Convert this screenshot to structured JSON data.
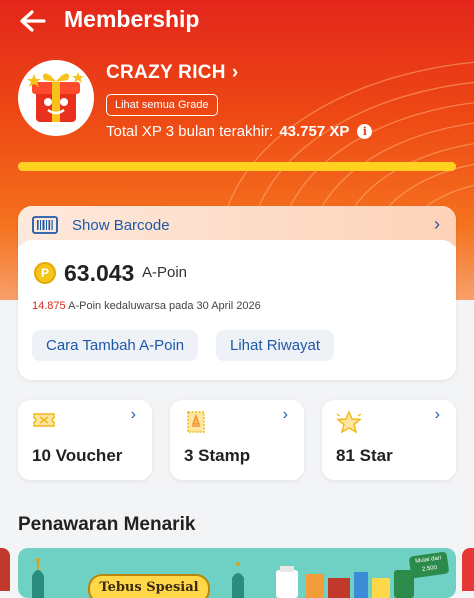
{
  "header": {
    "title": "Membership"
  },
  "profile": {
    "grade": "CRAZY RICH",
    "grade_button": "Lihat semua Grade",
    "xp_label": "Total XP 3 bulan terakhir:",
    "xp_value": "43.757 XP",
    "xp_progress": 1.0
  },
  "points_card": {
    "barcode_label": "Show Barcode",
    "coin_glyph": "P",
    "points_value": "63.043",
    "points_unit": "A-Poin",
    "expiry_amount": "14.875",
    "expiry_text": "A-Poin kedaluwarsa pada 30 April 2026",
    "actions": [
      "Cara Tambah A-Poin",
      "Lihat Riwayat"
    ]
  },
  "rewards": [
    {
      "label": "10 Voucher",
      "icon": "voucher-icon"
    },
    {
      "label": "3 Stamp",
      "icon": "stamp-icon"
    },
    {
      "label": "81 Star",
      "icon": "star-icon"
    }
  ],
  "offers": {
    "title": "Penawaran Menarik",
    "banner_title": "Tebus Spesial",
    "banner_badge": "Mulai dari 2.500"
  },
  "colors": {
    "brand_red": "#e3261b",
    "link_blue": "#1f58a8",
    "progress": "#ffd21f"
  }
}
